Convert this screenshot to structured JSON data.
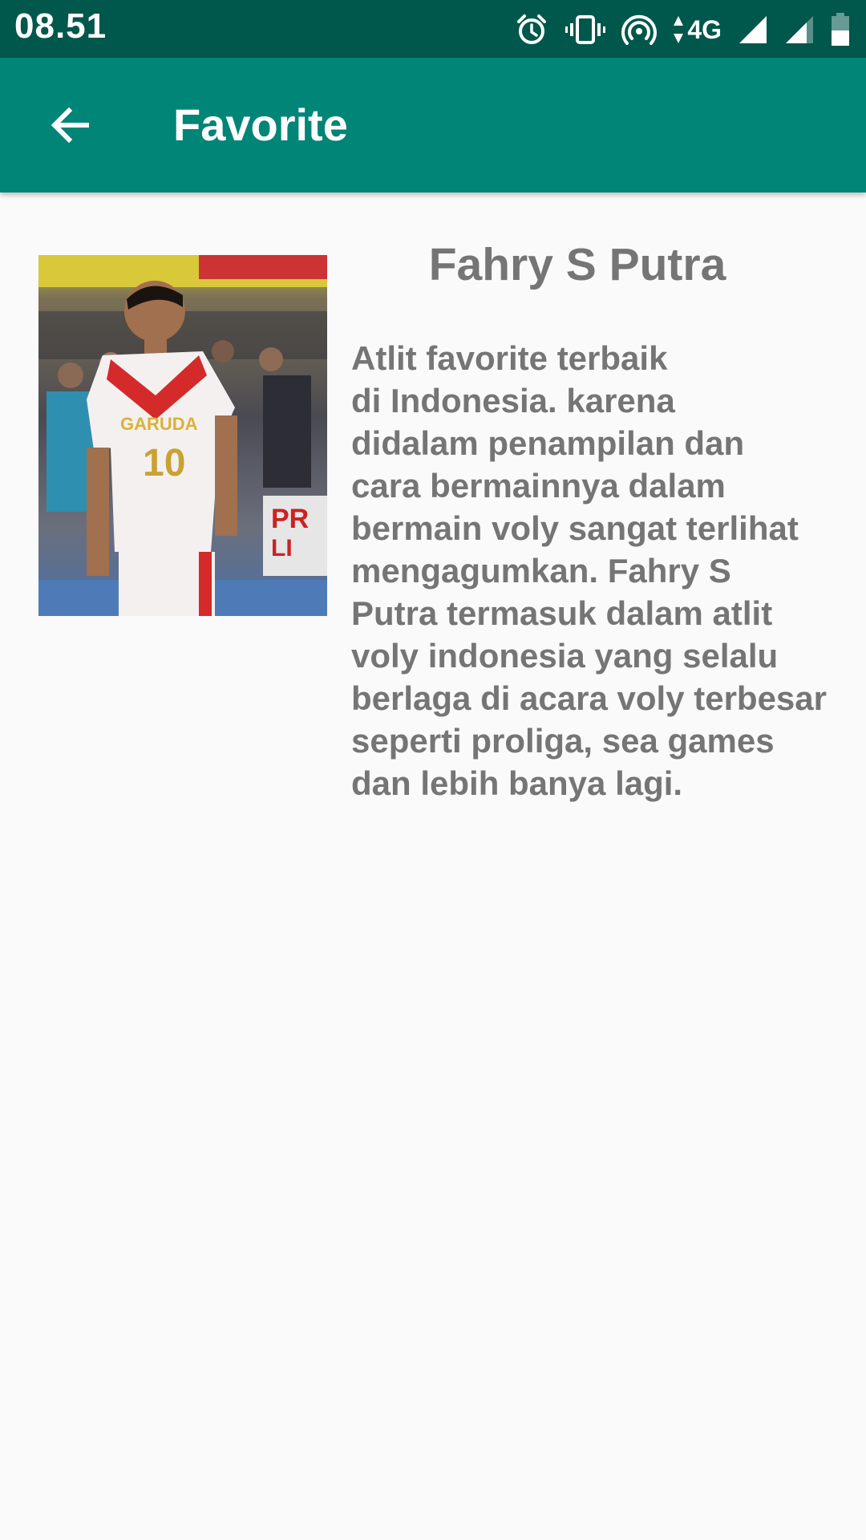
{
  "status_bar": {
    "time": "08.51",
    "network": "4G",
    "icons": [
      "alarm-icon",
      "vibrate-icon",
      "hotspot-icon",
      "data-arrows-icon",
      "signal-icon",
      "signal-icon",
      "battery-icon"
    ]
  },
  "app_bar": {
    "title": "Favorite",
    "back_icon": "arrow-back-icon",
    "color": "#008577",
    "status_color": "#00574b"
  },
  "athlete": {
    "name": "Fahry S Putra",
    "description": "Atlit favorite terbaik\ndi Indonesia. karena\ndidalam penampilan dan\ncara bermainnya dalam\nbermain voly sangat terlihat\nmengagumkan. Fahry S\nPutra termasuk dalam atlit\nvoly indonesia yang selalu\nberlaga di acara voly terbesar\nseperti proliga, sea games\ndan lebih banya lagi.",
    "photo_jersey_text": "GARUDA",
    "photo_jersey_number": "10"
  }
}
